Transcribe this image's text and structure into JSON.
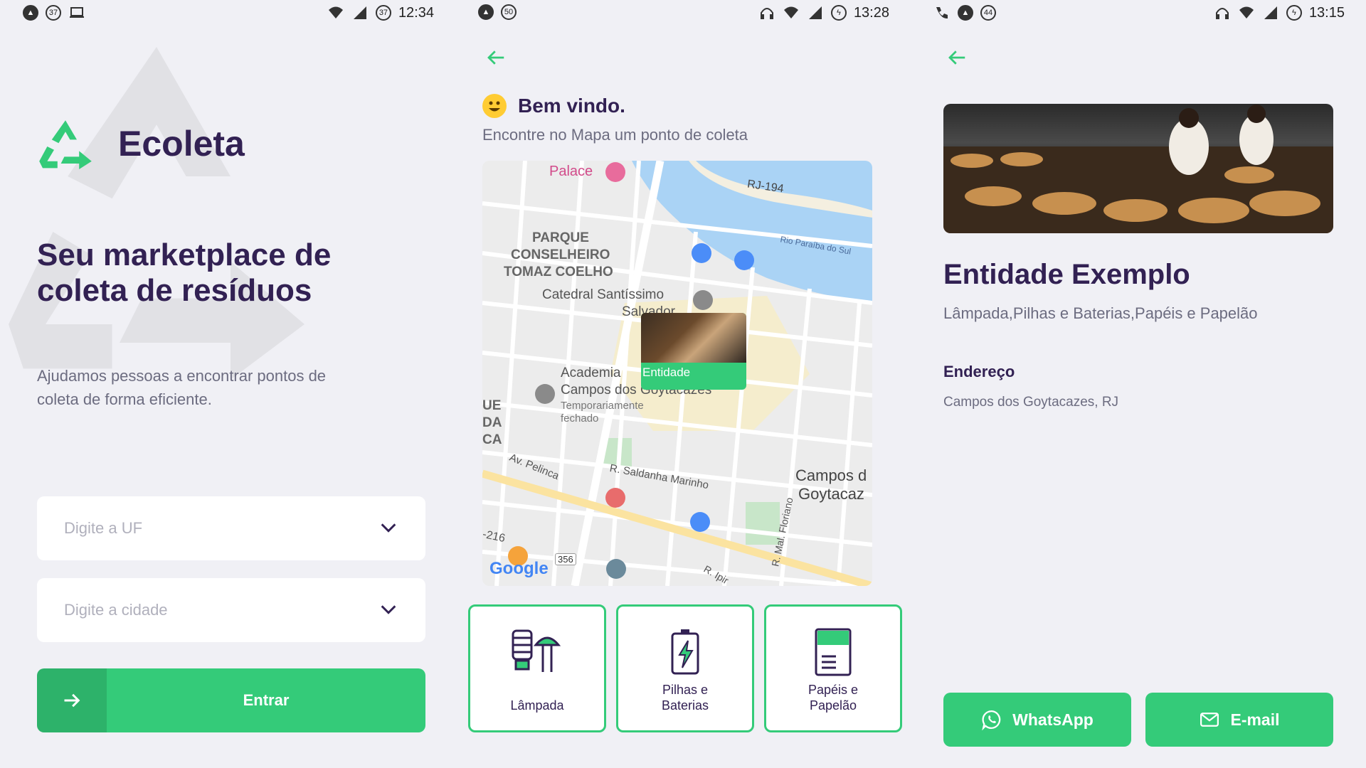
{
  "screen_home": {
    "status": {
      "notif_count": "37",
      "battery_level": "37",
      "time": "12:34"
    },
    "app_name": "Ecoleta",
    "headline": "Seu marketplace de coleta de resíduos",
    "description": "Ajudamos pessoas a encontrar pontos de coleta de forma eficiente.",
    "uf_placeholder": "Digite a UF",
    "city_placeholder": "Digite a cidade",
    "enter_label": "Entrar"
  },
  "screen_map": {
    "status": {
      "notif_count": "50",
      "time": "13:28"
    },
    "welcome_title": "Bem vindo.",
    "subtitle": "Encontre no Mapa um ponto de coleta",
    "map_labels": {
      "palace": "Palace",
      "road_rj194": "RJ-194",
      "river": "Rio Paraíba do Sul",
      "park_line1": "PARQUE",
      "park_line2": "CONSELHEIRO",
      "park_line3": "TOMAZ COELHO",
      "cathedral_line1": "Catedral Santíssimo",
      "cathedral_line2": "Salvador",
      "academy_line1": "Academia",
      "academy_line2": "Campos dos Goytacazes",
      "academy_status_line1": "Temporariamente",
      "academy_status_line2": "fechado",
      "street_pelinca": "Av. Pelinca",
      "street_saldanha": "R. Saldanha Marinho",
      "street_floriano": "R. Mal. Floriano",
      "city_line1": "Campos d",
      "city_line2": "Goytacaz",
      "edge_1": "UE",
      "edge_2": "DA",
      "edge_3": "CA",
      "road_216": "-216",
      "road_356": "356",
      "google": "Google",
      "street_ipir": "R. Ipir"
    },
    "marker_label": "Entidade",
    "items": [
      {
        "label": "Lâmpada"
      },
      {
        "label_line1": "Pilhas e",
        "label_line2": "Baterias"
      },
      {
        "label_line1": "Papéis e",
        "label_line2": "Papelão"
      }
    ]
  },
  "screen_detail": {
    "status": {
      "notif_count": "44",
      "time": "13:15"
    },
    "entity_name": "Entidade Exemplo",
    "entity_items": "Lâmpada,Pilhas e Baterias,Papéis e Papelão",
    "address_title": "Endereço",
    "address_value": "Campos dos Goytacazes, RJ",
    "whatsapp_label": "WhatsApp",
    "email_label": "E-mail"
  },
  "colors": {
    "primary": "#34CB79",
    "title": "#322153",
    "text": "#6C6C80",
    "background": "#F0F0F5"
  }
}
